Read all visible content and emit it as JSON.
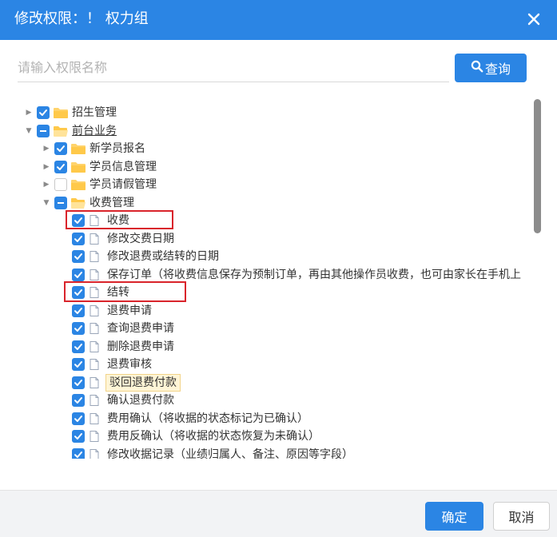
{
  "dialog": {
    "title": "修改权限：！ 权力组",
    "close_icon": "close-icon"
  },
  "search": {
    "placeholder": "请输入权限名称",
    "value": "",
    "button_label": "查询",
    "button_icon": "search-icon"
  },
  "tree": {
    "nodes": [
      {
        "label": "招生管理",
        "level": 0,
        "expander": "collapsed",
        "check": "checked",
        "icon": "folder-icon",
        "underline": false,
        "selected": false
      },
      {
        "label": "前台业务",
        "level": 0,
        "expander": "expanded",
        "check": "partial",
        "icon": "folder-open-icon",
        "underline": true,
        "selected": false
      },
      {
        "label": "新学员报名",
        "level": 1,
        "expander": "collapsed",
        "check": "checked",
        "icon": "folder-icon",
        "underline": false,
        "selected": false
      },
      {
        "label": "学员信息管理",
        "level": 1,
        "expander": "collapsed",
        "check": "checked",
        "icon": "folder-icon",
        "underline": false,
        "selected": false
      },
      {
        "label": "学员请假管理",
        "level": 1,
        "expander": "collapsed",
        "check": "unchecked",
        "icon": "folder-icon",
        "underline": false,
        "selected": false
      },
      {
        "label": "收费管理",
        "level": 1,
        "expander": "expanded",
        "check": "partial",
        "icon": "folder-open-icon",
        "underline": false,
        "selected": false
      },
      {
        "label": "收费",
        "level": 2,
        "expander": "none",
        "check": "checked",
        "icon": "file-icon",
        "underline": false,
        "selected": false
      },
      {
        "label": "修改交费日期",
        "level": 2,
        "expander": "none",
        "check": "checked",
        "icon": "file-icon",
        "underline": false,
        "selected": false
      },
      {
        "label": "修改退费或结转的日期",
        "level": 2,
        "expander": "none",
        "check": "checked",
        "icon": "file-icon",
        "underline": false,
        "selected": false
      },
      {
        "label": "保存订单（将收费信息保存为预制订单，再由其他操作员收费，也可由家长在手机上",
        "level": 2,
        "expander": "none",
        "check": "checked",
        "icon": "file-icon",
        "underline": false,
        "selected": false
      },
      {
        "label": "结转",
        "level": 2,
        "expander": "none",
        "check": "checked",
        "icon": "file-icon",
        "underline": false,
        "selected": false
      },
      {
        "label": "退费申请",
        "level": 2,
        "expander": "none",
        "check": "checked",
        "icon": "file-icon",
        "underline": false,
        "selected": false
      },
      {
        "label": "查询退费申请",
        "level": 2,
        "expander": "none",
        "check": "checked",
        "icon": "file-icon",
        "underline": false,
        "selected": false
      },
      {
        "label": "删除退费申请",
        "level": 2,
        "expander": "none",
        "check": "checked",
        "icon": "file-icon",
        "underline": false,
        "selected": false
      },
      {
        "label": "退费审核",
        "level": 2,
        "expander": "none",
        "check": "checked",
        "icon": "file-icon",
        "underline": false,
        "selected": false
      },
      {
        "label": "驳回退费付款",
        "level": 2,
        "expander": "none",
        "check": "checked",
        "icon": "file-icon",
        "underline": false,
        "selected": true
      },
      {
        "label": "确认退费付款",
        "level": 2,
        "expander": "none",
        "check": "checked",
        "icon": "file-icon",
        "underline": false,
        "selected": false
      },
      {
        "label": "费用确认（将收据的状态标记为已确认）",
        "level": 2,
        "expander": "none",
        "check": "checked",
        "icon": "file-icon",
        "underline": false,
        "selected": false
      },
      {
        "label": "费用反确认（将收据的状态恢复为未确认）",
        "level": 2,
        "expander": "none",
        "check": "checked",
        "icon": "file-icon",
        "underline": false,
        "selected": false
      },
      {
        "label": "修改收据记录（业绩归属人、备注、原因等字段）",
        "level": 2,
        "expander": "none",
        "check": "checked",
        "icon": "file-icon",
        "underline": false,
        "selected": false
      }
    ],
    "highlighted": [
      "收费",
      "结转"
    ]
  },
  "footer": {
    "ok_label": "确定",
    "cancel_label": "取消"
  },
  "colors": {
    "primary": "#2b85e4",
    "highlight": "#d9242b",
    "folder": "#ffd36b",
    "selected_bg": "#fff5d6"
  }
}
